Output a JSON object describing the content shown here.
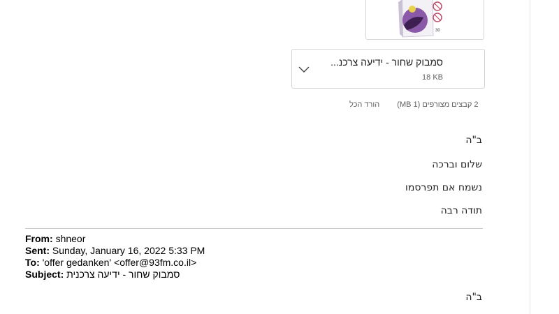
{
  "attachments": {
    "files": [
      {
        "name": "סמבוק שחור - ידיעה צרכנ...",
        "size": "18 KB"
      }
    ],
    "summary": "2 קבצים מצורפים (1 MB)",
    "download_all": "הורד הכל",
    "thumbnail_badge": "30"
  },
  "body": {
    "line1": "ב\"ה",
    "line2": "שלום וברכה",
    "line3": "נשמח אם תפרסמו",
    "line4": "תודה רבה"
  },
  "forwarded": {
    "from_label": "From:",
    "from_value": "shneor",
    "sent_label": "Sent:",
    "sent_value": "Sunday, January 16, 2022 5:33 PM",
    "to_label": "To:",
    "to_value": "'offer gedanken' <offer@93fm.co.il>",
    "subject_label": "Subject:",
    "subject_value": "סמבוק שחור - ידיעה צרכנית",
    "body_line1": "ב\"ה"
  },
  "colors": {
    "text": "#201f1e",
    "muted": "#605e5c",
    "border": "#d4d4d4",
    "thumb_purple": "#7b4a9c"
  }
}
